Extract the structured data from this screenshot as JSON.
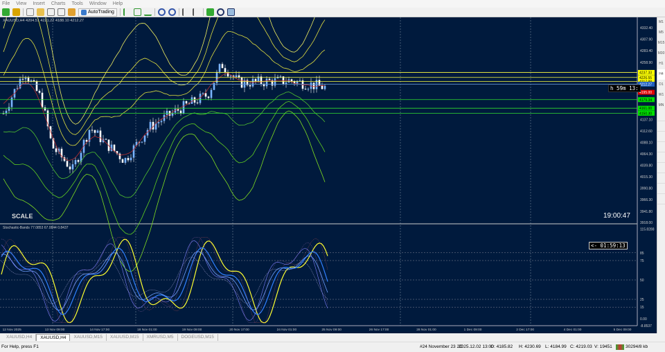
{
  "menu": [
    "File",
    "View",
    "Insert",
    "Charts",
    "Tools",
    "Window",
    "Help"
  ],
  "toolbar": {
    "autotrading": "AutoTrading"
  },
  "chart": {
    "header": "XAUUSD,H4 4204.51 4221.22 4188.10 4212.27",
    "scale_label": "SCALE",
    "clock": "19:00:47",
    "timer_main": "h 59m 13:",
    "timer_ind": "<- 01:59:13",
    "price_axis": [
      "4332.40",
      "4307.90",
      "4283.40",
      "4258.90",
      "4137.10",
      "4112.60",
      "4088.10",
      "4064.30",
      "4039.80",
      "4015.30",
      "3990.80",
      "3966.30",
      "3941.80",
      "3918.00"
    ],
    "price_tags": [
      {
        "text": "4237.33",
        "color": "#ffff00"
      },
      {
        "text": "4226.55",
        "color": "#ffff00"
      },
      {
        "text": "4217.88",
        "color": "#ffff00"
      },
      {
        "text": "4212.27",
        "color": "#2060c0"
      },
      {
        "text": "4195.00",
        "color": "#e00000"
      },
      {
        "text": "4179.34",
        "color": "#00e000"
      },
      {
        "text": "4161.00",
        "color": "#00e000"
      },
      {
        "text": "4150.30",
        "color": "#00e000"
      }
    ],
    "indicator_header": "Stochastic-Bands 77.0853 67.0844 0.8437",
    "indicator_axis": [
      "115.8288",
      "85",
      "75",
      "50",
      "25",
      "15",
      "0.00",
      "-8.8537"
    ],
    "time_axis": [
      "12 Nov 2025",
      "13 Nov 09:00",
      "14 Nov 17:00",
      "18 Nov 01:00",
      "19 Nov 09:00",
      "20 Nov 17:00",
      "24 Nov 01:00",
      "25 Nov 09:00",
      "26 Nov 17:00",
      "28 Nov 01:00",
      "1 Dec 09:00",
      "2 Dec 17:00",
      "4 Dec 01:00",
      "5 Dec 09:00",
      "8 Dec 17:00"
    ]
  },
  "timeframes": [
    "M1",
    "M5",
    "M15",
    "M30",
    "H1",
    "H4",
    "D1",
    "W1",
    "MN"
  ],
  "tabs": [
    "XAUUSD,H4",
    "XAUUSD,H4",
    "XAUUSD,M15",
    "XAUUSD,M15",
    "XMRUSD,M5",
    "DOGEUSD,M15"
  ],
  "active_tab": 1,
  "status": {
    "help": "For Help, press F1",
    "bar": "#24 November 23 2C",
    "time": "2025.12.02 13:00",
    "open": "O: 4185.82",
    "high": "H: 4230.69",
    "low": "L: 4184.99",
    "close": "C: 4219.03",
    "volume": "V: 19451",
    "traffic": "30294/8 kb"
  }
}
